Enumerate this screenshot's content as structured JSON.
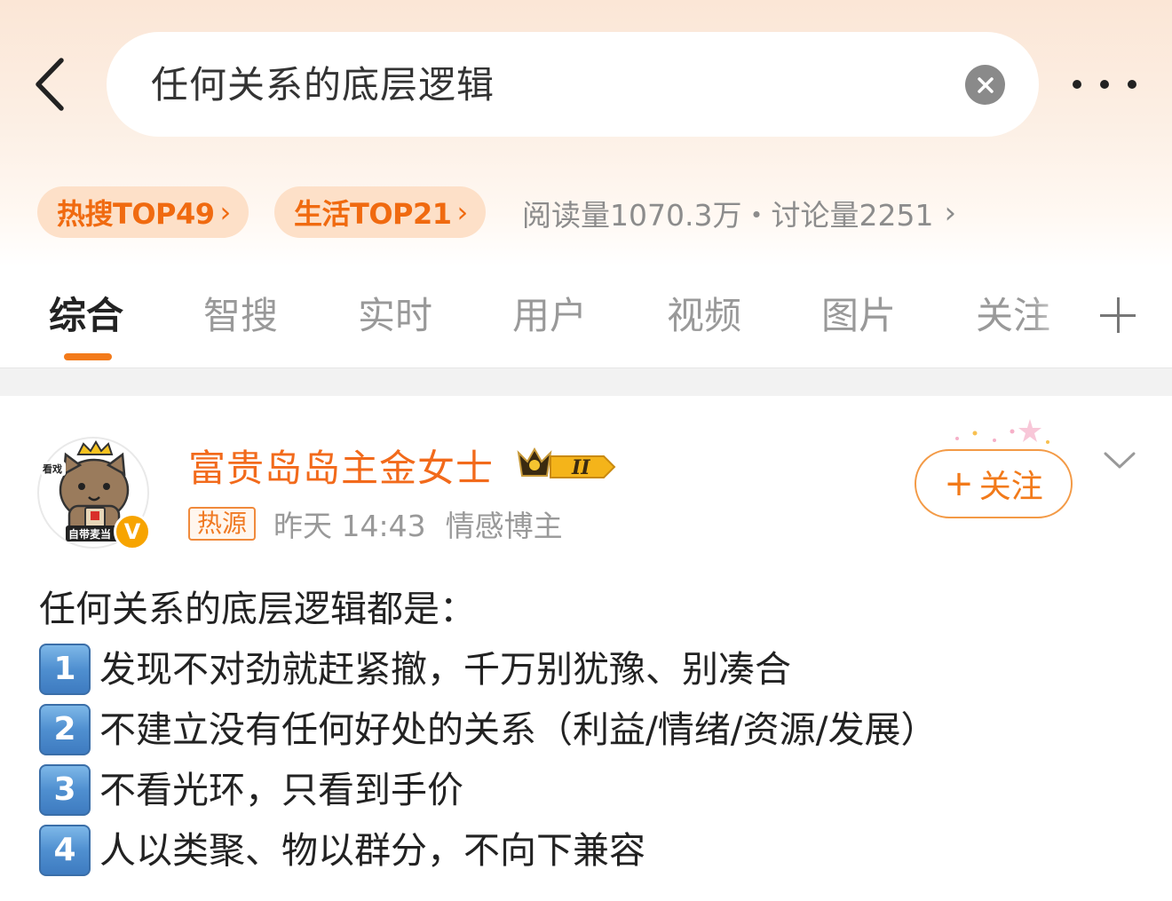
{
  "search": {
    "query": "任何关系的底层逻辑"
  },
  "topic": {
    "hot_search_label": "热搜TOP49",
    "life_label": "生活TOP21",
    "stats_text": "阅读量1070.3万・讨论量2251"
  },
  "tabs": [
    "综合",
    "智搜",
    "实时",
    "用户",
    "视频",
    "图片",
    "关注"
  ],
  "post": {
    "author": "富贵岛岛主金女士",
    "level": "II",
    "avatar_text_top": "看戏",
    "avatar_text_bottom": "自带麦当",
    "verified_mark": "V",
    "hot_tag": "热源",
    "time": "昨天 14:43",
    "role": "情感博主",
    "follow_label": "关注",
    "intro": "任何关系的底层逻辑都是：",
    "points": [
      {
        "num": "1",
        "text": "发现不对劲就赶紧撤，千万别犹豫、别凑合"
      },
      {
        "num": "2",
        "text": "不建立没有任何好处的关系（利益/情绪/资源/发展）"
      },
      {
        "num": "3",
        "text": "不看光环，只看到手价"
      },
      {
        "num": "4",
        "text": "人以类聚、物以群分，不向下兼容"
      }
    ]
  },
  "colors": {
    "accent": "#f26a1b",
    "pill_bg": "#fde0c8",
    "key_blue": "#4f8fd0"
  }
}
